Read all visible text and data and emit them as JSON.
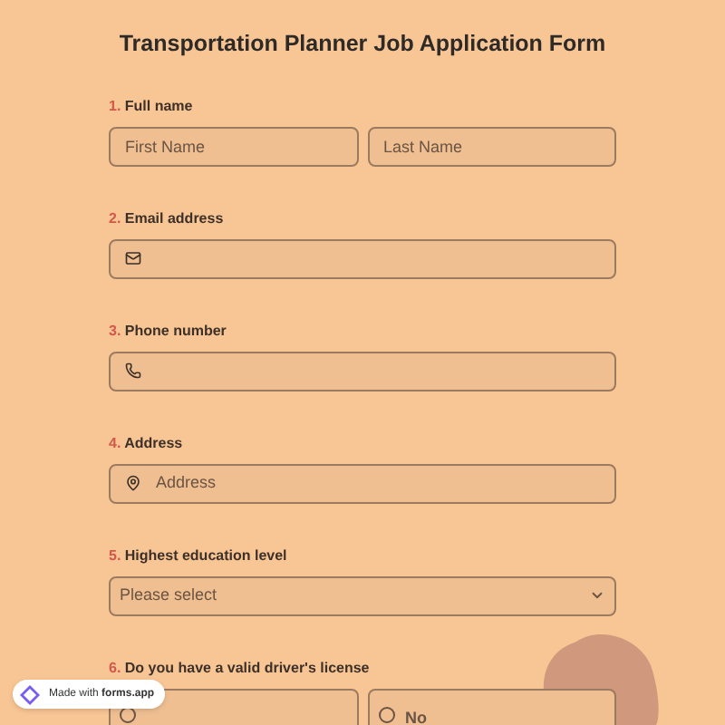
{
  "title": "Transportation Planner Job Application Form",
  "questions": [
    {
      "number": "1.",
      "label": "Full name",
      "kind": "name",
      "placeholders": [
        "First Name",
        "Last Name"
      ]
    },
    {
      "number": "2.",
      "label": "Email address",
      "kind": "email"
    },
    {
      "number": "3.",
      "label": "Phone number",
      "kind": "phone"
    },
    {
      "number": "4.",
      "label": "Address",
      "kind": "address",
      "placeholder": "Address"
    },
    {
      "number": "5.",
      "label": "Highest education level",
      "kind": "select",
      "value": "Please select"
    },
    {
      "number": "6.",
      "label": "Do you have a valid driver's license",
      "kind": "radio",
      "options": [
        {
          "selected": false
        },
        {
          "label": "No",
          "selected": false
        }
      ]
    }
  ],
  "badge": {
    "prefix": "Made with",
    "brand": "forms.app"
  }
}
